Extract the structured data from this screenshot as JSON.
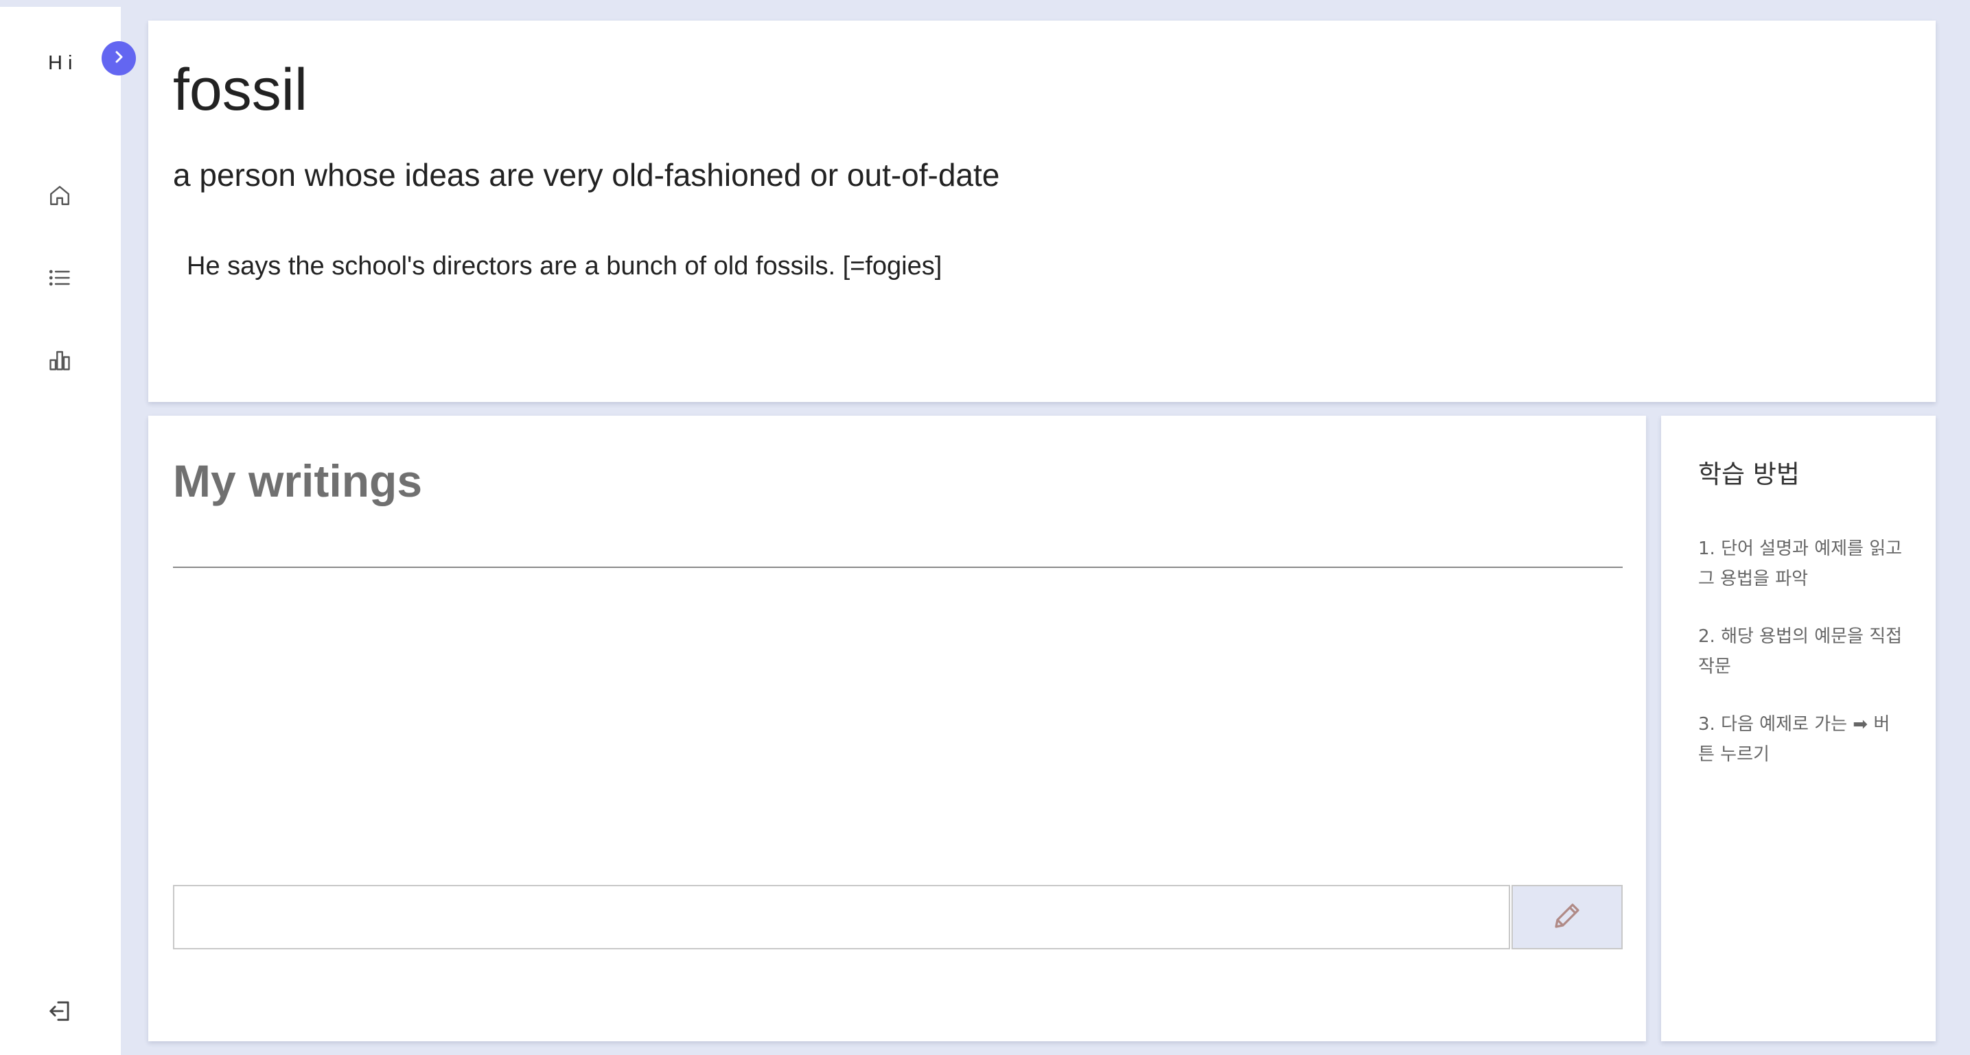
{
  "sidebar": {
    "greeting": "Hi",
    "expand_icon": "chevron-right-icon",
    "accent_color": "#6366f1",
    "items": [
      {
        "icon": "home-icon"
      },
      {
        "icon": "list-icon"
      },
      {
        "icon": "bar-chart-icon"
      }
    ],
    "logout_icon": "logout-icon"
  },
  "word": {
    "term": "fossil",
    "definition": "a person whose ideas are very old-fashioned or out-of-date",
    "example": "He says the school's directors are a bunch of old fossils. [=fogies]"
  },
  "writings": {
    "title": "My writings",
    "input_value": "",
    "input_placeholder": "",
    "submit_icon": "pencil-icon"
  },
  "guide": {
    "title": "학습 방법",
    "steps": [
      "1. 단어 설명과 예제를 읽고 그 용법을 파악",
      "2. 해당 용법의 예문을 직접 작문",
      "3. 다음 예제로 가는 ➡ 버튼 누르기"
    ]
  }
}
